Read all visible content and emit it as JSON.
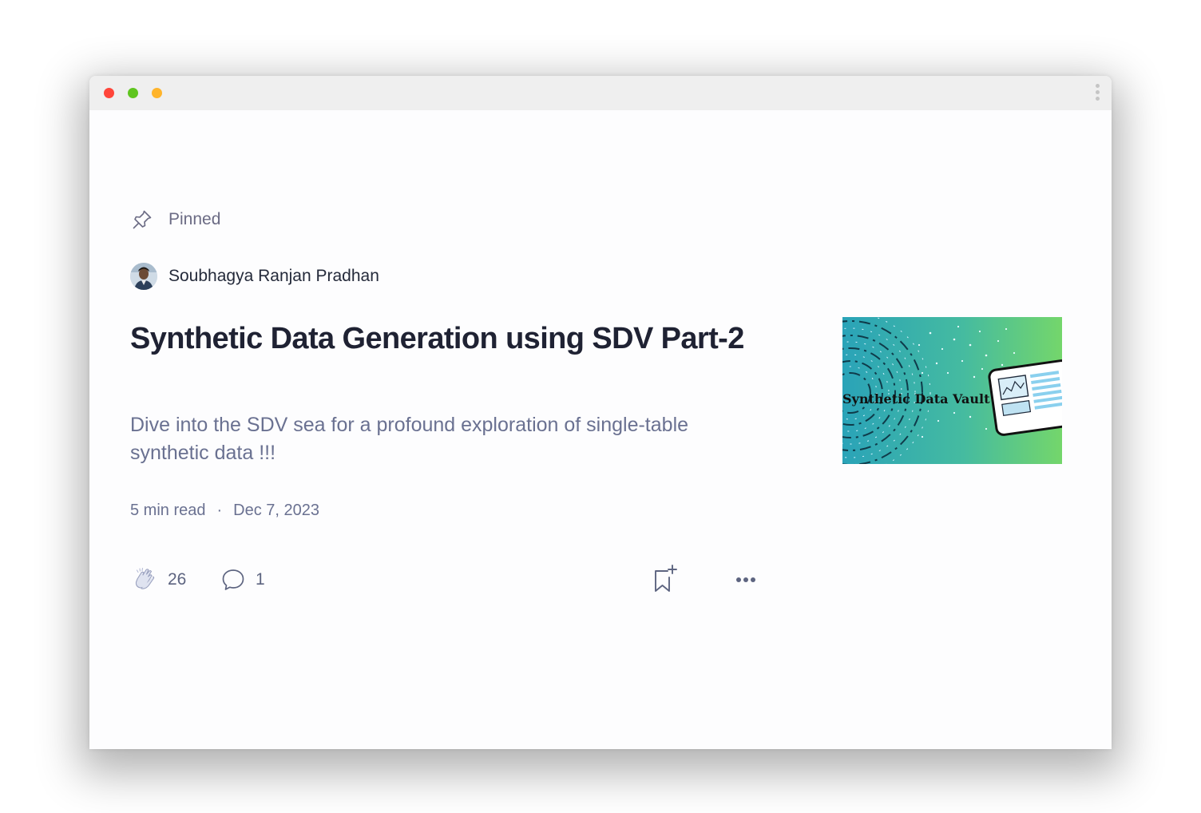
{
  "window": {
    "traffic_lights": [
      "#ff453a",
      "#5fc51f",
      "#ffb42b"
    ],
    "menu_icon": "vertical-dots-icon"
  },
  "post": {
    "pinned_label": "Pinned",
    "pin_icon": "pin-icon",
    "author": "Soubhagya Ranjan Pradhan",
    "title": "Synthetic Data Generation using SDV Part-2",
    "subtitle": "Dive into the SDV sea for a profound exploration of single-table synthetic data !!!",
    "read_time": "5 min read",
    "separator": "·",
    "date": "Dec 7, 2023",
    "thumbnail_text": "Synthetic Data Vault",
    "claps": "26",
    "responses": "1"
  },
  "icons": {
    "clap": "clap-icon",
    "response": "speech-bubble-icon",
    "save": "bookmark-add-icon",
    "more": "more-dots-icon"
  },
  "colors": {
    "title": "#1f2233",
    "muted": "#6a7191",
    "thumb_gradient_start": "#2aa3b8",
    "thumb_gradient_end": "#74d66b"
  }
}
